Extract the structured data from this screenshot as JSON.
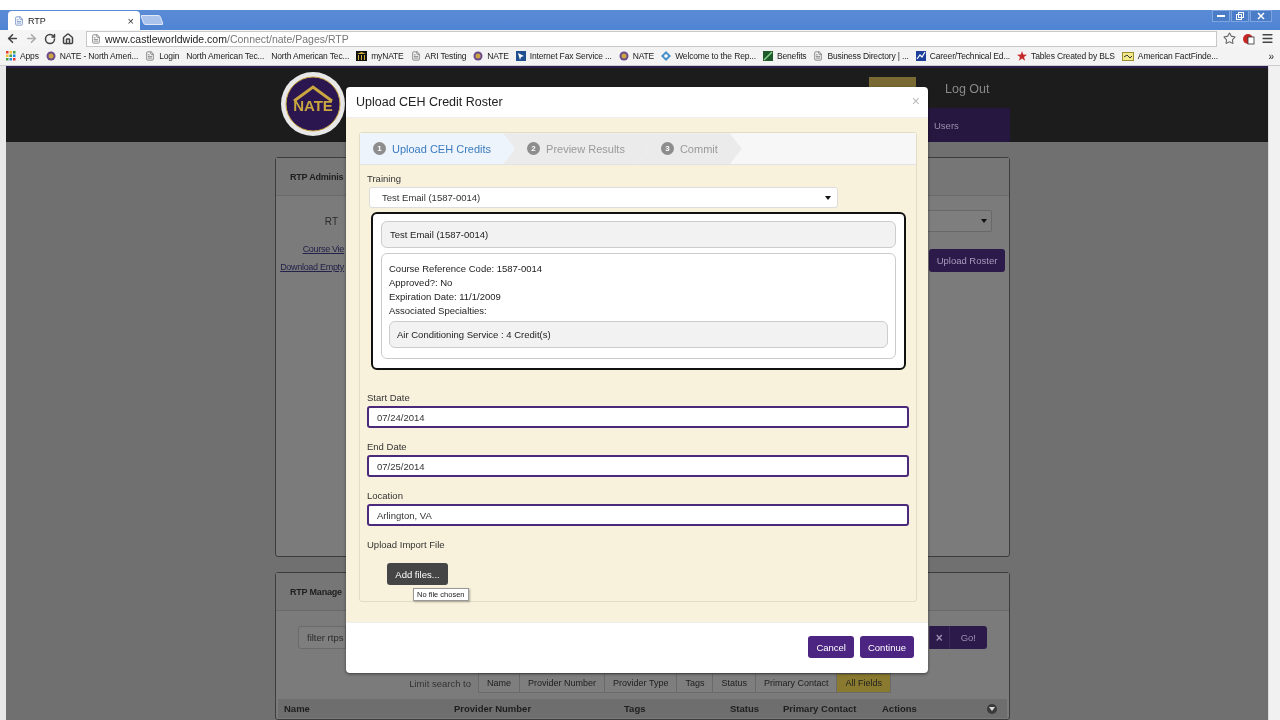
{
  "browser": {
    "tab": {
      "title": "RTP",
      "close": "×"
    },
    "url": {
      "host": "www.castleworldwide.com",
      "path": "/Connect/nate/Pages/RTP"
    },
    "bookmarks": [
      {
        "label": "Apps",
        "kind": "grid"
      },
      {
        "label": "NATE - North Ameri...",
        "kind": "seal"
      },
      {
        "label": "Login",
        "kind": "doc"
      },
      {
        "label": "North American Tec...",
        "kind": "plain"
      },
      {
        "label": "North American Tec...",
        "kind": "plain"
      },
      {
        "label": "myNATE",
        "kind": "building"
      },
      {
        "label": "ARI Testing",
        "kind": "doc"
      },
      {
        "label": "NATE",
        "kind": "seal"
      },
      {
        "label": "Internet Fax Service ...",
        "kind": "fax"
      },
      {
        "label": "NATE",
        "kind": "seal"
      },
      {
        "label": "Welcome to the Rep...",
        "kind": "diamond"
      },
      {
        "label": "Benefits",
        "kind": "leaf"
      },
      {
        "label": "Business Directory | ...",
        "kind": "doc"
      },
      {
        "label": "Career/Technical Ed...",
        "kind": "chart"
      },
      {
        "label": "Tables Created by BLS",
        "kind": "star"
      },
      {
        "label": "American FactFinde...",
        "kind": "card"
      }
    ],
    "more": "»"
  },
  "header": {
    "logo_text": "NATE",
    "logout": "Log Out",
    "nav": [
      {
        "label": "Users",
        "selected": true
      }
    ]
  },
  "admin_panel": {
    "title": "RTP Adminis",
    "field_label": "RT",
    "links": [
      "Course Vie",
      "Download Empty"
    ],
    "button": "Upload Roster"
  },
  "manage_panel": {
    "title": "RTP Manage",
    "filter_placeholder": "filter rtps",
    "clear": "×",
    "go": "Go!",
    "limit_label": "Limit search to",
    "limit_tabs": [
      {
        "label": "Name",
        "selected": false
      },
      {
        "label": "Provider Number",
        "selected": false
      },
      {
        "label": "Provider Type",
        "selected": false
      },
      {
        "label": "Tags",
        "selected": false
      },
      {
        "label": "Status",
        "selected": false
      },
      {
        "label": "Primary Contact",
        "selected": false
      },
      {
        "label": "All Fields",
        "selected": true
      }
    ],
    "columns": [
      "Name",
      "Provider Number",
      "Tags",
      "Status",
      "Primary Contact",
      "Actions"
    ]
  },
  "modal": {
    "title": "Upload CEH Credit Roster",
    "close": "×",
    "steps": [
      {
        "number": "1",
        "label": "Upload CEH Credits",
        "selected": true
      },
      {
        "number": "2",
        "label": "Preview Results",
        "selected": false
      },
      {
        "number": "3",
        "label": "Commit",
        "selected": false
      }
    ],
    "training_label": "Training",
    "training_value": "Test Email (1587-0014)",
    "detail": {
      "title": "Test Email (1587-0014)",
      "lines": [
        "Course Reference Code: 1587-0014",
        "Approved?: No",
        "Expiration Date: 11/1/2009",
        "Associated Specialties:"
      ],
      "specialties": [
        "Air Conditioning Service : 4 Credit(s)"
      ]
    },
    "fields": [
      {
        "label": "Start Date",
        "value": "07/24/2014"
      },
      {
        "label": "End Date",
        "value": "07/25/2014"
      },
      {
        "label": "Location",
        "value": "Arlington, VA"
      }
    ],
    "upload_label": "Upload Import File",
    "add_button": "Add files...",
    "tooltip": "No file chosen",
    "buttons": [
      "Cancel",
      "Continue"
    ]
  }
}
